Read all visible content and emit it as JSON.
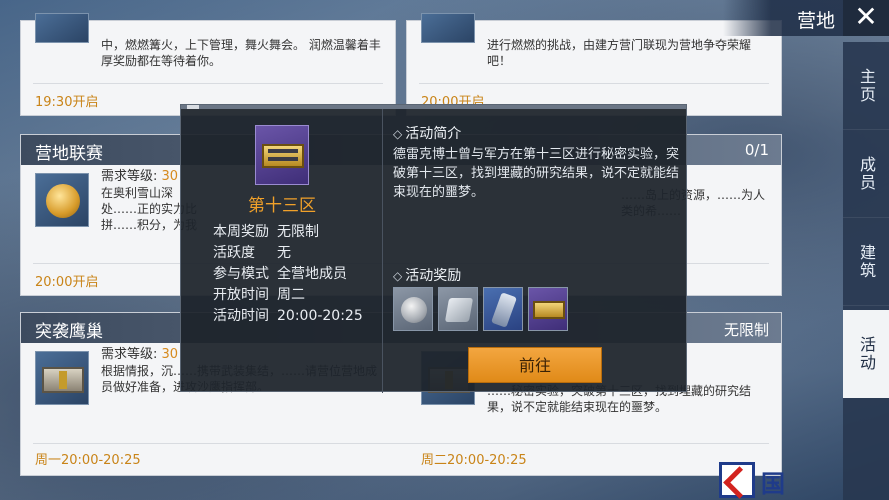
{
  "header": {
    "title": "营地",
    "close_icon": "close-icon"
  },
  "sidebar": {
    "tabs": [
      {
        "label": "主页",
        "active": false
      },
      {
        "label": "成员",
        "active": false
      },
      {
        "label": "建筑",
        "active": false
      },
      {
        "label": "活动",
        "active": true
      }
    ]
  },
  "cards": {
    "top_left": {
      "text": "中，燃燃篝火，上下管理，舞火舞会。 润燃温馨着丰厚奖励都在等待着你。",
      "time": "19:30开启"
    },
    "top_right": {
      "text": "进行燃燃的挑战，由建方营门联现为营地争夺荣耀吧！",
      "time": "20:00开启"
    },
    "league": {
      "title": "营地联赛",
      "count": "0/1",
      "req_label": "需求等级:",
      "req_value": "30",
      "text": "在奥利雪山深处……正的实力比拼……积分，为我方……",
      "text_right": "……岛上的资源，……为人类的希……",
      "time": "20:00开启"
    },
    "raid": {
      "title": "突袭鹰巢",
      "limit": "无限制",
      "req_label": "需求等级:",
      "req_value": "30",
      "text": "根据情报，沉……携带武装集结，……请营位营地成员做好准备，进攻沙鹰指挥部。",
      "text_right": "……秘密实验，突破第十三区，找到埋藏的研究结果，说不定就能结束现在的噩梦。",
      "time_left": "周一20:00-20:25",
      "time_right": "周二20:00-20:25"
    }
  },
  "modal": {
    "event_name": "第十三区",
    "info": [
      {
        "k": "本周奖励",
        "v": "无限制"
      },
      {
        "k": "活跃度",
        "v": "无"
      },
      {
        "k": "参与模式",
        "v": "全营地成员"
      },
      {
        "k": "开放时间",
        "v": "周二"
      },
      {
        "k": "活动时间",
        "v": "20:00-20:25"
      }
    ],
    "intro_title": "活动简介",
    "intro_text": "德雷克博士曾与军方在第十三区进行秘密实验，突破第十三区，找到埋藏的研究结果，说不定就能结束现在的噩梦。",
    "rewards_title": "活动奖励",
    "rewards": [
      "silver-coin-icon",
      "armor-plate-icon",
      "device-icon",
      "gold-crate-icon"
    ],
    "goto_label": "前往"
  },
  "watermark": {
    "text": "国"
  },
  "colors": {
    "accent": "#f0a12a",
    "button": "#e08a18"
  }
}
